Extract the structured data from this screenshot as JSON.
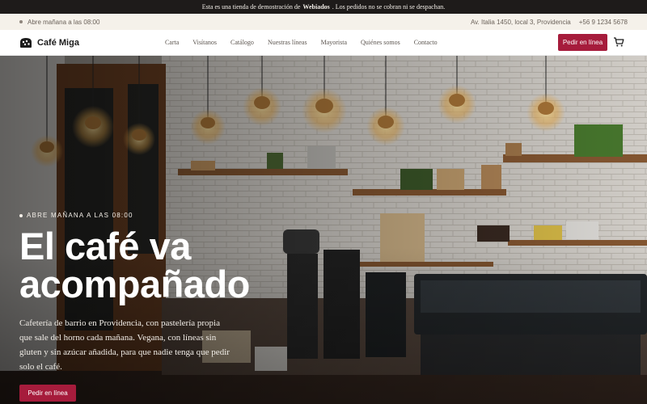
{
  "demo_notice": {
    "before": "Esta es una tienda de demostración de",
    "brand": "Webiados",
    "after": ". Los pedidos no se cobran ni se despachan."
  },
  "info_bar": {
    "hours": "Abre mañana a las 08:00",
    "address": "Av. Italia 1450, local 3, Providencia",
    "phone": "+56 9 1234 5678"
  },
  "nav": {
    "brand": "Café Miga",
    "logo_icon": "cookie-icon",
    "items": [
      "Carta",
      "Visítanos",
      "Catálogo",
      "Nuestras líneas",
      "Mayorista",
      "Quiénes somos",
      "Contacto"
    ],
    "cta": "Pedir en línea",
    "cart_icon": "cart-icon"
  },
  "hero": {
    "eyebrow": "ABRE MAÑANA A LAS 08:00",
    "title": "El café va acompañado",
    "description": "Cafetería de barrio en Providencia, con pastelería propia que sale del horno cada mañana. Vegana, con líneas sin gluten y sin azúcar añadida, para que nadie tenga que pedir solo el café.",
    "cta": "Pedir en línea"
  },
  "colors": {
    "accent": "#a61c3c",
    "strip": "#1e1b1a",
    "info_bg": "#f5f1ea"
  }
}
